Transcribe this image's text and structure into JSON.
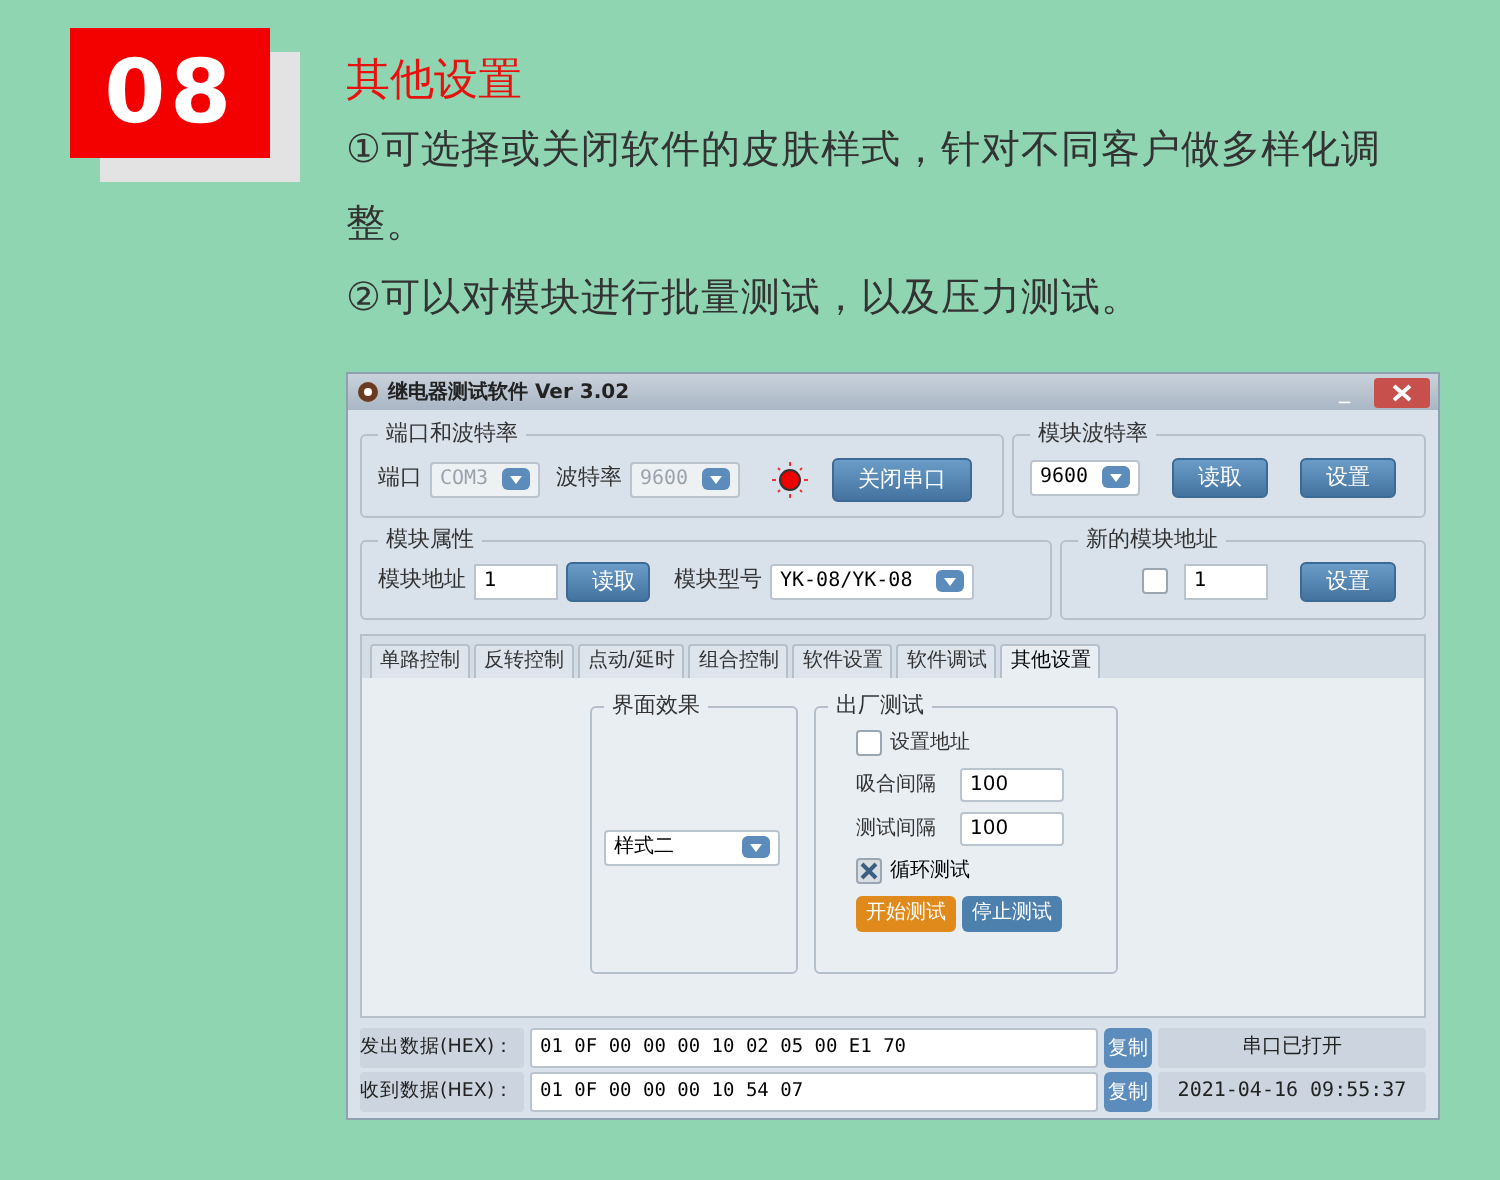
{
  "badge": "08",
  "heading": "其他设置",
  "paragraphs": [
    "①可选择或关闭软件的皮肤样式，针对不同客户做多样化调整。",
    "②可以对模块进行批量测试，以及压力测试。"
  ],
  "window": {
    "title": "继电器测试软件 Ver 3.02",
    "minimize": "_"
  },
  "port_group": {
    "title": "端口和波特率",
    "port_label": "端口",
    "port_value": "COM3",
    "baud_label": "波特率",
    "baud_value": "9600",
    "disabled": true,
    "led_on": true,
    "button": "关闭串口"
  },
  "module_baud": {
    "title": "模块波特率",
    "value": "9600",
    "buttons": [
      "读取",
      "设置"
    ]
  },
  "module_props": {
    "title": "模块属性",
    "address_label": "模块地址",
    "address_value": "1",
    "read_button": "读取",
    "model_label": "模块型号",
    "model_value": "YK-08/YK-08"
  },
  "new_address": {
    "title": "新的模块地址",
    "checked": false,
    "value": "1",
    "button": "设置"
  },
  "tabs": [
    {
      "label": "单路控制",
      "selected": false
    },
    {
      "label": "反转控制",
      "selected": false
    },
    {
      "label": "点动/延时",
      "selected": false
    },
    {
      "label": "组合控制",
      "selected": false
    },
    {
      "label": "软件设置",
      "selected": false
    },
    {
      "label": "软件调试",
      "selected": false
    },
    {
      "label": "其他设置",
      "selected": true
    }
  ],
  "skin_group": {
    "title": "界面效果",
    "value": "样式二"
  },
  "factory_test": {
    "title": "出厂测试",
    "set_address": {
      "label": "设置地址",
      "checked": false
    },
    "fields": [
      {
        "label": "吸合间隔",
        "value": "100"
      },
      {
        "label": "测试间隔",
        "value": "100"
      }
    ],
    "loop_test": {
      "label": "循环测试",
      "checked": true
    },
    "buttons": [
      {
        "label": "开始测试",
        "kind": "primary"
      },
      {
        "label": "停止测试",
        "kind": "secondary"
      }
    ]
  },
  "data_rows": [
    {
      "label": "发出数据(HEX)：",
      "value": "01 0F 00 00 00 10 02 05 00 E1 70",
      "copy": "复制",
      "status": "串口已打开"
    },
    {
      "label": "收到数据(HEX)：",
      "value": "01 0F 00 00 00 10 54 07",
      "copy": "复制",
      "status": "2021-04-16 09:55:37"
    }
  ]
}
